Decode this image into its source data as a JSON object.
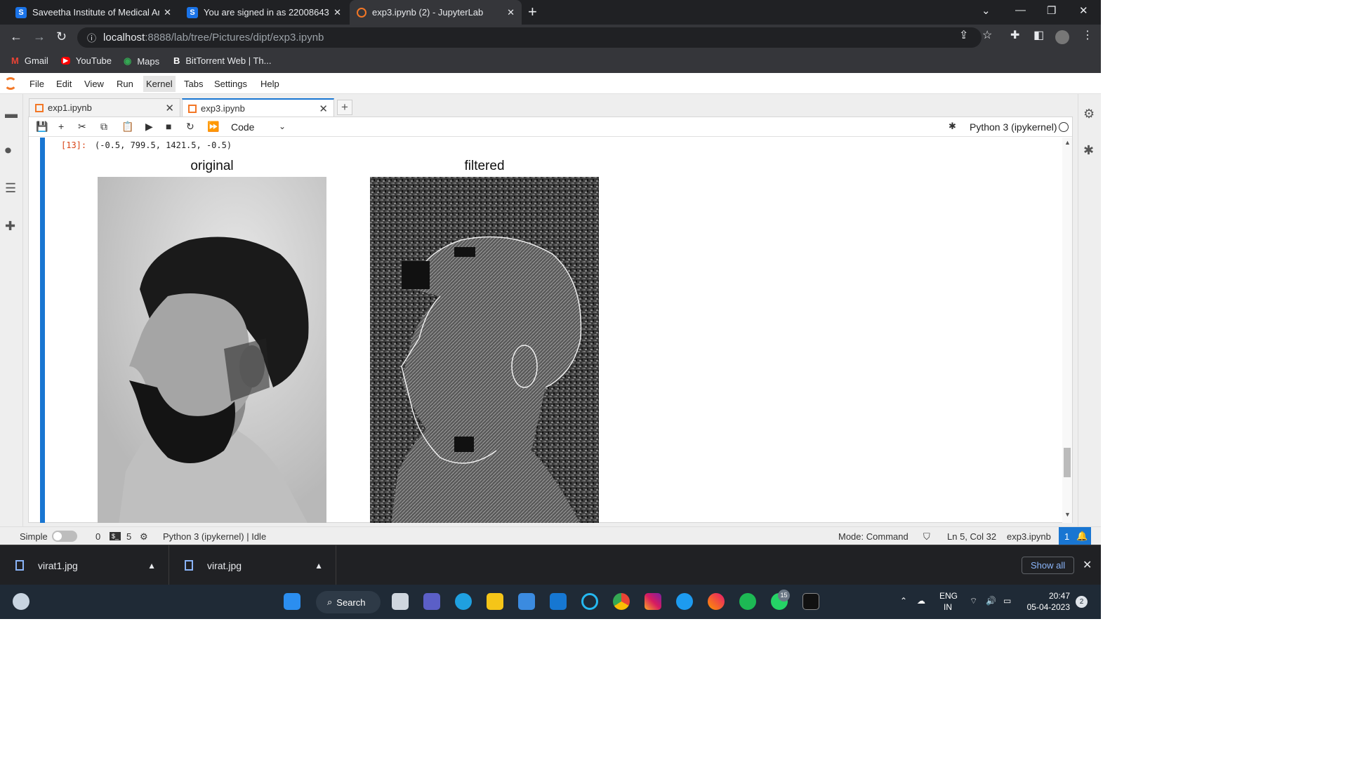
{
  "browser": {
    "tabs": [
      {
        "title": "Saveetha Institute of Medical And",
        "favicon": "S"
      },
      {
        "title": "You are signed in as 22008643",
        "favicon": "S"
      },
      {
        "title": "exp3.ipynb (2) - JupyterLab",
        "favicon": "jupyter"
      }
    ],
    "url_host": "localhost",
    "url_rest": ":8888/lab/tree/Pictures/dipt/exp3.ipynb",
    "bookmarks": [
      "Gmail",
      "YouTube",
      "Maps",
      "BitTorrent Web | Th..."
    ]
  },
  "jupyter": {
    "menu": [
      "File",
      "Edit",
      "View",
      "Run",
      "Kernel",
      "Tabs",
      "Settings",
      "Help"
    ],
    "doc_tabs": [
      "exp1.ipynb",
      "exp3.ipynb"
    ],
    "cell_type": "Code",
    "kernel_name": "Python 3 (ipykernel)",
    "output_prompt": "[13]:",
    "output_text": "(-0.5, 799.5, 1421.5, -0.5)",
    "figure_titles": {
      "left": "original",
      "right": "filtered"
    }
  },
  "statusbar": {
    "simple_label": "Simple",
    "terminals_count": "0",
    "kernels_count": "5",
    "kernel_state": "Python 3 (ipykernel) | Idle",
    "mode": "Mode: Command",
    "cursor": "Ln 5, Col 32",
    "file": "exp3.ipynb",
    "notifications": "1"
  },
  "downloads": {
    "items": [
      "virat1.jpg",
      "virat.jpg"
    ],
    "show_all": "Show all"
  },
  "taskbar": {
    "search_label": "Search",
    "whatsapp_badge": "15",
    "lang": "ENG",
    "region": "IN",
    "time": "20:47",
    "date": "05-04-2023",
    "notification_count": "2"
  }
}
